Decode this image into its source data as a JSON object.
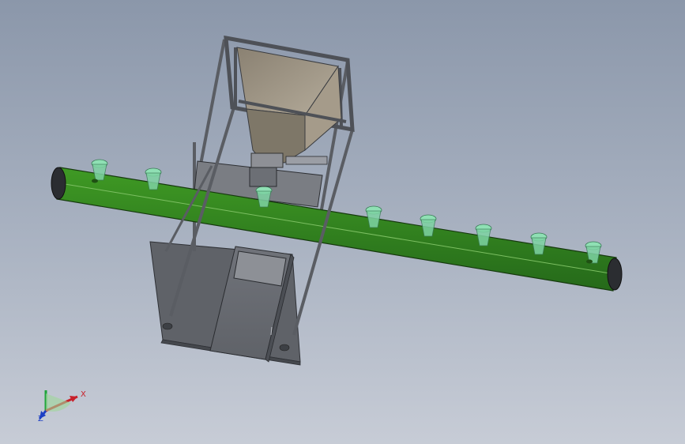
{
  "view": {
    "background_top": "#8b97aa",
    "background_bottom": "#c7ccd6"
  },
  "model": {
    "conveyor_color": "#2f7d1c",
    "frame_color": "#6b6e74",
    "cup_color": "#8fe0b4",
    "cup_count": 10
  },
  "triad": {
    "x_label": "X",
    "z_label": "Z",
    "x_color": "#c8202a",
    "y_color": "#1fa43a",
    "z_color": "#1d3fc4"
  }
}
